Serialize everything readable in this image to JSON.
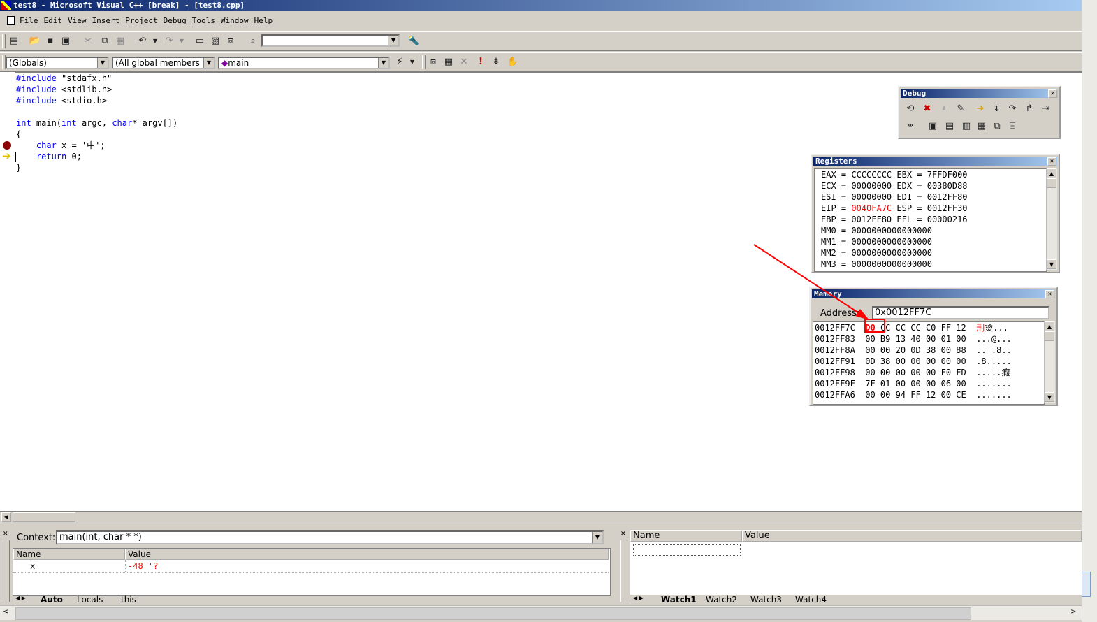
{
  "window": {
    "title": "test8 - Microsoft Visual C++ [break] - [test8.cpp]"
  },
  "menu": [
    "File",
    "Edit",
    "View",
    "Insert",
    "Project",
    "Debug",
    "Tools",
    "Window",
    "Help"
  ],
  "wizard_bar": {
    "scope": "(Globals)",
    "members": "(All global members",
    "function": "main"
  },
  "code": {
    "line1_kw": "#include",
    "line1_rest": " \"stdafx.h\"",
    "line2_kw": "#include",
    "line2_rest": " <stdlib.h>",
    "line3_kw": "#include",
    "line3_rest": " <stdio.h>",
    "line5_kw1": "int",
    "line5_mid1": " main(",
    "line5_kw2": "int",
    "line5_mid2": " argc, ",
    "line5_kw3": "char",
    "line5_rest": "* argv[])",
    "line6": "{",
    "line7_kw": "char",
    "line7_rest": " x = '中';",
    "line8_kw": "return",
    "line8_rest": " 0;",
    "line9": "}"
  },
  "debug_toolbar": {
    "title": "Debug"
  },
  "registers": {
    "title": "Registers",
    "rows": [
      {
        "a": "EAX = CCCCCCCC",
        "b": " EBX = 7FFDF000"
      },
      {
        "a": "ECX = 00000000",
        "b": " EDX = 00380D88"
      },
      {
        "a": "ESI = 00000000",
        "b": " EDI = 0012FF80"
      },
      {
        "a": "EBP = 0012FF80",
        "b": " EFL = 00000216"
      },
      {
        "a": "MM0 = 0000000000000000",
        "b": ""
      },
      {
        "a": "MM1 = 0000000000000000",
        "b": ""
      },
      {
        "a": "MM2 = 0000000000000000",
        "b": ""
      },
      {
        "a": "MM3 = 0000000000000000",
        "b": ""
      }
    ],
    "eip_label": "EIP = ",
    "eip_value": "0040FA7C",
    "esp": " ESP = 0012FF30",
    "changed_color": "#ff0000"
  },
  "memory": {
    "title": "Memory",
    "address_label": "Address:",
    "address_value": "0x0012FF7C",
    "first_addr": "0012FF7C",
    "first_byte": "D0",
    "first_rest": "CC CC CC C0 FF 12",
    "first_ascii_red": "刑",
    "first_ascii_rest": "烫...",
    "rows": [
      {
        "addr": "0012FF83",
        "bytes": "00 B9 13 40 00 01 00",
        "ascii": "...@..."
      },
      {
        "addr": "0012FF8A",
        "bytes": "00 00 20 0D 38 00 88",
        "ascii": ".. .8.."
      },
      {
        "addr": "0012FF91",
        "bytes": "0D 38 00 00 00 00 00",
        "ascii": ".8....."
      },
      {
        "addr": "0012FF98",
        "bytes": "00 00 00 00 00 F0 FD",
        "ascii": ".....瘕"
      },
      {
        "addr": "0012FF9F",
        "bytes": "7F 01 00 00 00 06 00",
        "ascii": "......."
      },
      {
        "addr": "0012FFA6",
        "bytes": "00 00 94 FF 12 00 CE",
        "ascii": "......."
      }
    ]
  },
  "variables": {
    "context_label": "Context:",
    "context_value": "main(int, char * *)",
    "col_name": "Name",
    "col_value": "Value",
    "row_name": "x",
    "row_value": "-48 '?",
    "tabs": [
      "Auto",
      "Locals",
      "this"
    ]
  },
  "watch": {
    "col_name": "Name",
    "col_value": "Value",
    "tabs": [
      "Watch1",
      "Watch2",
      "Watch3",
      "Watch4"
    ]
  },
  "annotation": {
    "arrow_color": "#ff0000"
  }
}
